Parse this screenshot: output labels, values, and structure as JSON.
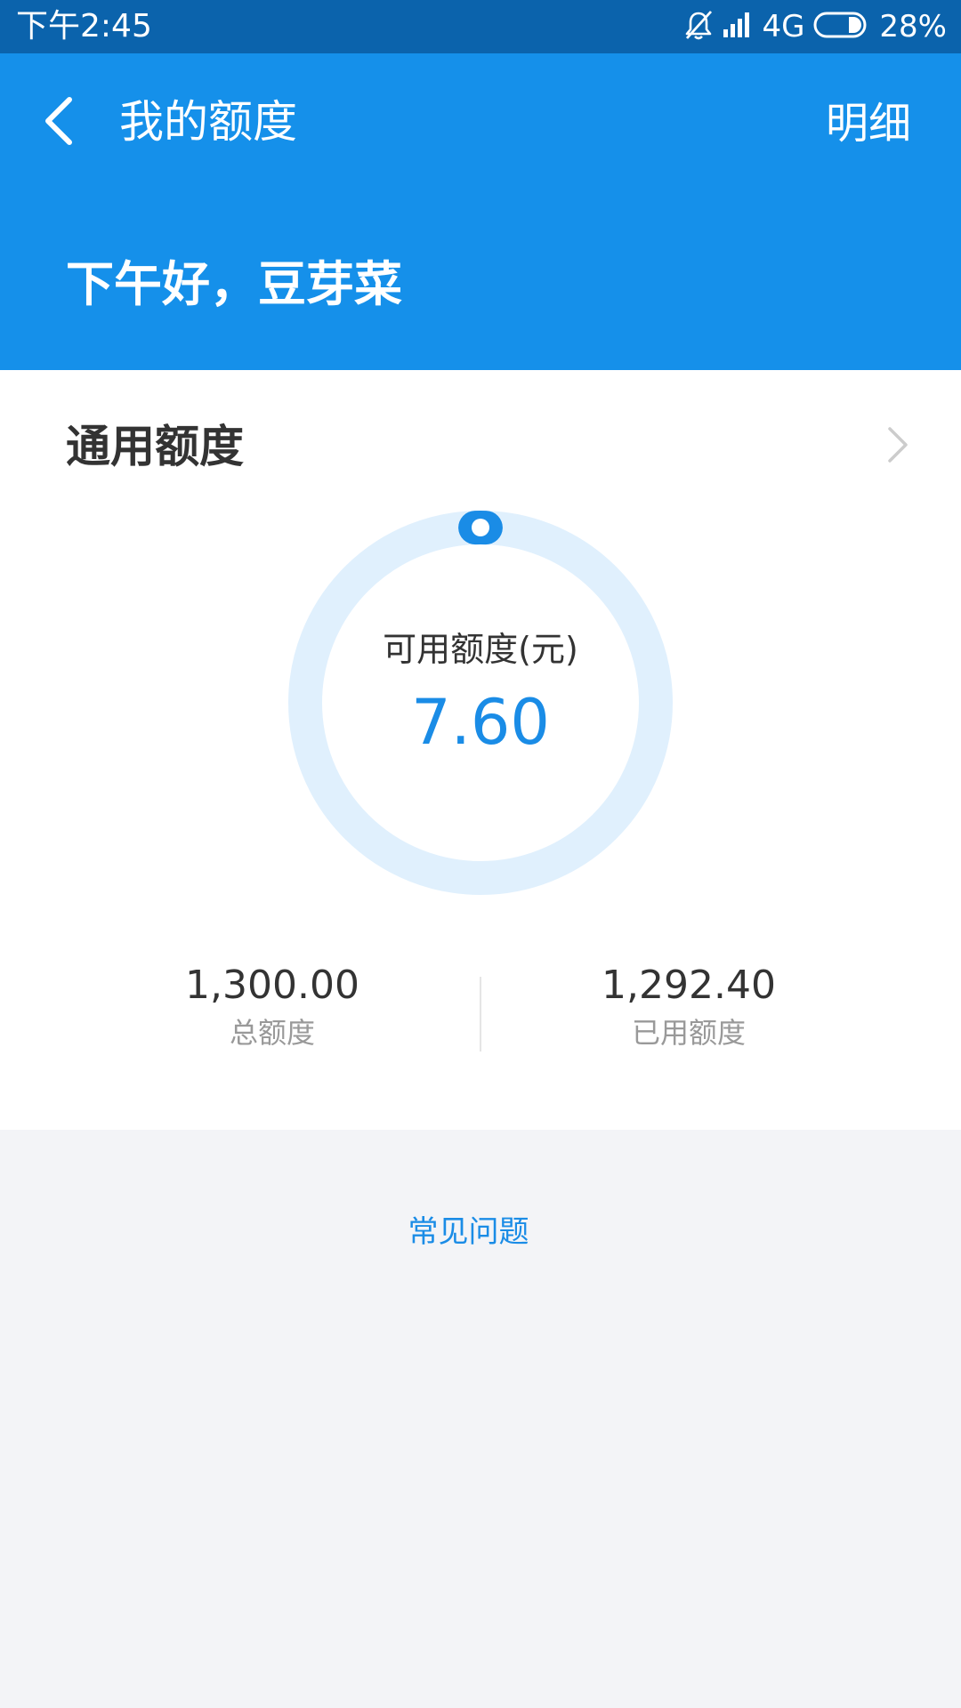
{
  "status_bar": {
    "time": "下午2:45",
    "network": "4G",
    "battery": "28%",
    "battery_level": 0.28,
    "icons": [
      "bell-muted-icon",
      "signal-icon",
      "battery-icon"
    ]
  },
  "header": {
    "title": "我的额度",
    "action_label": "明细",
    "greeting": "下午好，豆芽菜",
    "background_color": "#1590ea"
  },
  "credit": {
    "section_title": "通用额度",
    "available_label": "可用额度(元)",
    "available_value": "7.60",
    "available_ratio": 0.0058,
    "total_value": "1,300.00",
    "total_label": "总额度",
    "used_value": "1,292.40",
    "used_label": "已用额度",
    "accent_color": "#1a8ce6",
    "ring_track_color": "#e0f0fd"
  },
  "footer": {
    "faq_label": "常见问题"
  }
}
